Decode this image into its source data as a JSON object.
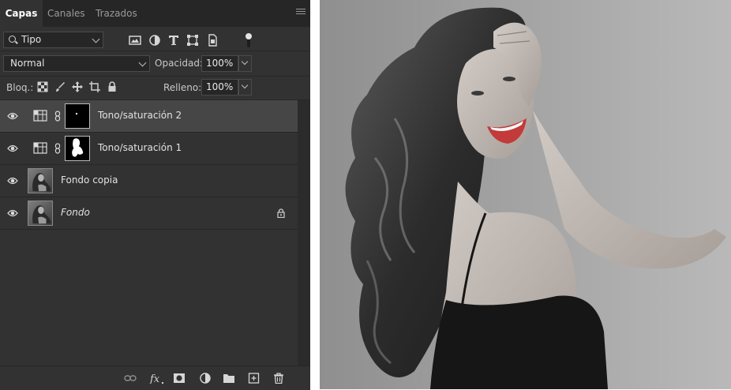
{
  "tabs": [
    {
      "label": "Capas"
    },
    {
      "label": "Canales"
    },
    {
      "label": "Trazados"
    }
  ],
  "filter": {
    "kind_label": "Tipo"
  },
  "blend": {
    "mode": "Normal",
    "opacity_label": "Opacidad:",
    "opacity_value": "100%"
  },
  "lock": {
    "label": "Bloq.:",
    "fill_label": "Relleno:",
    "fill_value": "100%"
  },
  "layers": [
    {
      "name": "Tono/saturación 2",
      "type": "adjustment",
      "visible": true,
      "selected": true
    },
    {
      "name": "Tono/saturación 1",
      "type": "adjustment",
      "visible": true,
      "selected": false
    },
    {
      "name": "Fondo copia",
      "type": "pixel",
      "visible": true,
      "selected": false
    },
    {
      "name": "Fondo",
      "type": "background",
      "visible": true,
      "locked": true,
      "selected": false
    }
  ],
  "footer_icons": [
    "link-layers-icon",
    "fx-icon",
    "add-mask-icon",
    "adjustment-layer-icon",
    "group-folder-icon",
    "new-layer-icon",
    "trash-icon"
  ],
  "colors": {
    "panel": "#323232",
    "tabbar": "#262626",
    "selected_row": "#464646",
    "accent_lips": "#c23a3a"
  }
}
